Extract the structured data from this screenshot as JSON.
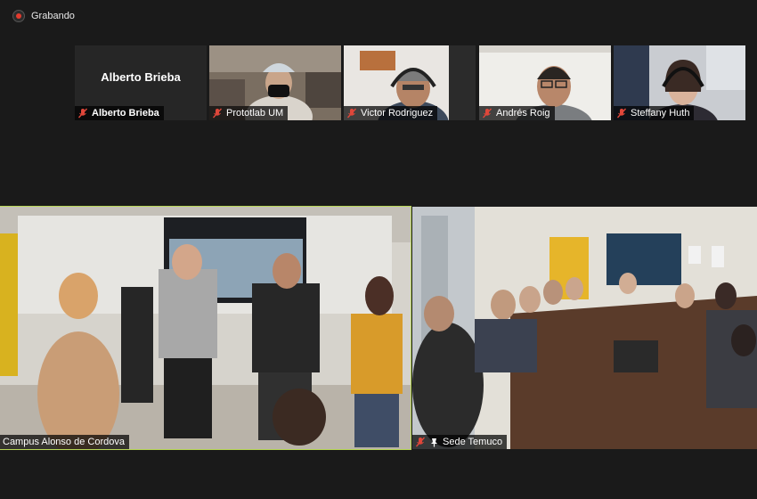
{
  "recording": {
    "label": "Grabando"
  },
  "participants_strip": [
    {
      "name": "Alberto Brieba",
      "display": "name-only",
      "mic_muted": true
    },
    {
      "name": "Prototlab UM",
      "display": "video",
      "mic_muted": true
    },
    {
      "name": "Victor Rodriguez",
      "display": "video",
      "mic_muted": true
    },
    {
      "name": "Andrés Roig",
      "display": "video",
      "mic_muted": true
    },
    {
      "name": "Steffany Huth",
      "display": "video",
      "mic_muted": true
    }
  ],
  "main_tiles": [
    {
      "name": "Campus Alonso de Cordova",
      "active_speaker": true,
      "mic_muted": false
    },
    {
      "name": "Sede Temuco",
      "active_speaker": false,
      "mic_muted": true,
      "pinned": true
    }
  ],
  "colors": {
    "background": "#1a1a1a",
    "active_speaker_border": "#b8d657",
    "muted_mic": "#e0473a",
    "recording_dot": "#e23b2e"
  }
}
